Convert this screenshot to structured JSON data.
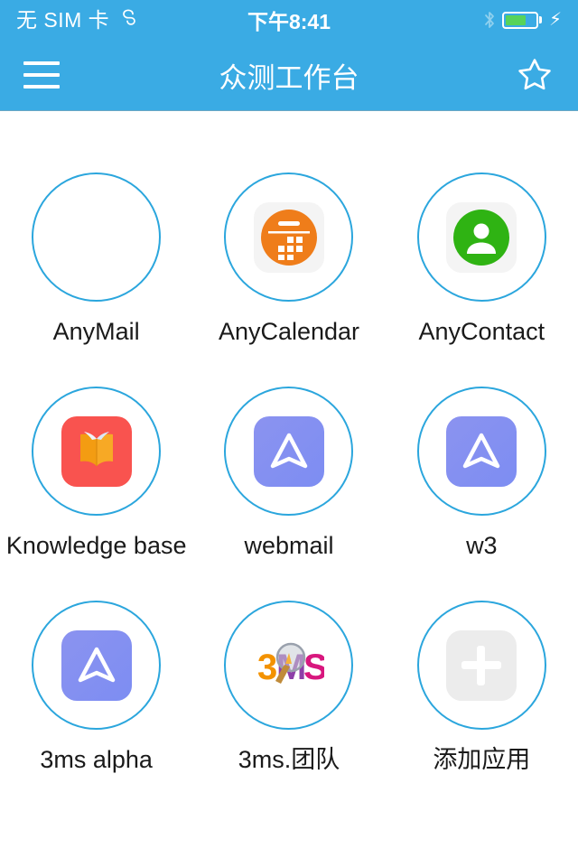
{
  "status_bar": {
    "carrier": "无 SIM 卡",
    "carrier_icon": "loop-icon",
    "loop_glyph": "ℛ",
    "time": "下午8:41",
    "bluetooth_icon": "bluetooth-icon",
    "battery_level_percent": 70,
    "battery_charging": true,
    "charging_glyph": "⚡",
    "background_color": "#3aabe4",
    "text_color": "#ffffff"
  },
  "nav_bar": {
    "menu_icon": "hamburger-menu-icon",
    "title": "众测工作台",
    "favorite_icon": "star-outline-icon",
    "background_color": "#3aabe4"
  },
  "app_grid": {
    "circle_border_color": "#2ba6dd",
    "apps": [
      {
        "label": "AnyMail",
        "icon": "empty-icon",
        "icon_type": "none"
      },
      {
        "label": "AnyCalendar",
        "icon": "calendar-icon",
        "icon_type": "calendar",
        "tile_color": "#f4f4f4",
        "accent_color": "#ef7d1a"
      },
      {
        "label": "AnyContact",
        "icon": "contact-person-icon",
        "icon_type": "contact",
        "tile_color": "#f4f4f4",
        "accent_color": "#2fb313"
      },
      {
        "label": "Knowledge base",
        "icon": "open-book-icon",
        "icon_type": "book",
        "tile_color": "#f9534f",
        "accent_color": "#f7a020"
      },
      {
        "label": "webmail",
        "icon": "navigation-arrow-icon",
        "icon_type": "arrow",
        "tile_color": "#8b93f0",
        "accent_color": "#ffffff"
      },
      {
        "label": "w3",
        "icon": "navigation-arrow-icon",
        "icon_type": "arrow",
        "tile_color": "#8b93f0",
        "accent_color": "#ffffff"
      },
      {
        "label": "3ms alpha",
        "icon": "navigation-arrow-icon",
        "icon_type": "arrow",
        "tile_color": "#8b93f0",
        "accent_color": "#ffffff"
      },
      {
        "label": "3ms.团队",
        "icon": "3ms-logo-icon",
        "icon_type": "logo3ms",
        "logo_text": "3MS"
      },
      {
        "label": "添加应用",
        "icon": "plus-icon",
        "icon_type": "plus",
        "tile_color": "#ececec",
        "accent_color": "#ffffff"
      }
    ]
  }
}
